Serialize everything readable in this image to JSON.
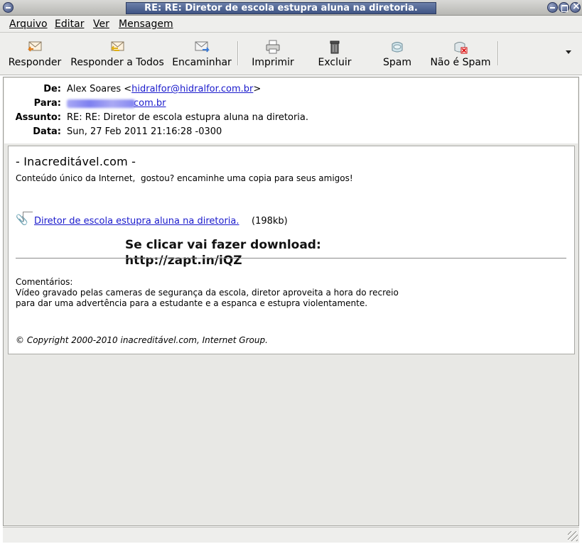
{
  "window": {
    "title": "RE: RE: Diretor de escola estupra aluna na diretoria."
  },
  "menubar": {
    "items": [
      {
        "label": "Arquivo"
      },
      {
        "label": "Editar"
      },
      {
        "label": "Ver"
      },
      {
        "label": "Mensagem"
      }
    ]
  },
  "toolbar": {
    "reply": {
      "label": "Responder",
      "icon": "reply-icon"
    },
    "reply_all": {
      "label": "Responder a Todos",
      "icon": "reply-all-icon"
    },
    "forward": {
      "label": "Encaminhar",
      "icon": "forward-icon"
    },
    "print": {
      "label": "Imprimir",
      "icon": "printer-icon"
    },
    "delete": {
      "label": "Excluir",
      "icon": "trash-icon"
    },
    "spam": {
      "label": "Spam",
      "icon": "spam-icon"
    },
    "not_spam": {
      "label": "Não é Spam",
      "icon": "not-spam-icon"
    }
  },
  "headers": {
    "from_label": "De:",
    "from_name": "Alex Soares <",
    "from_email": "hidralfor@hidralfor.com.br",
    "from_close": ">",
    "to_label": "Para:",
    "to_email_visible": "com.br",
    "subject_label": "Assunto:",
    "subject": "RE: RE: Diretor de escola estupra aluna na diretoria.",
    "date_label": "Data:",
    "date": "Sun, 27 Feb 2011 21:16:28 -0300"
  },
  "message": {
    "site_title": "- Inacreditável.com -",
    "intro": "Conteúdo único da Internet,  gostou? encaminhe uma copia para seus amigos!",
    "attachment": {
      "name": "Diretor de escola estupra aluna na diretoria.",
      "size": "(198kb)"
    },
    "overlay_line1": "Se clicar vai fazer download:",
    "overlay_line2": "http://zapt.in/iQZ",
    "comments_label": "Comentários:",
    "comments_line1": "Vídeo gravado pelas cameras de segurança da escola, diretor aproveita a hora do recreio",
    "comments_line2": "para dar uma advertência para a estudante e a espanca e estupra violentamente.",
    "copyright": "© Copyright 2000-2010 inacreditável.com, Internet Group."
  },
  "colors": {
    "link": "#1a1acc",
    "title_bar": "#3f5484"
  }
}
